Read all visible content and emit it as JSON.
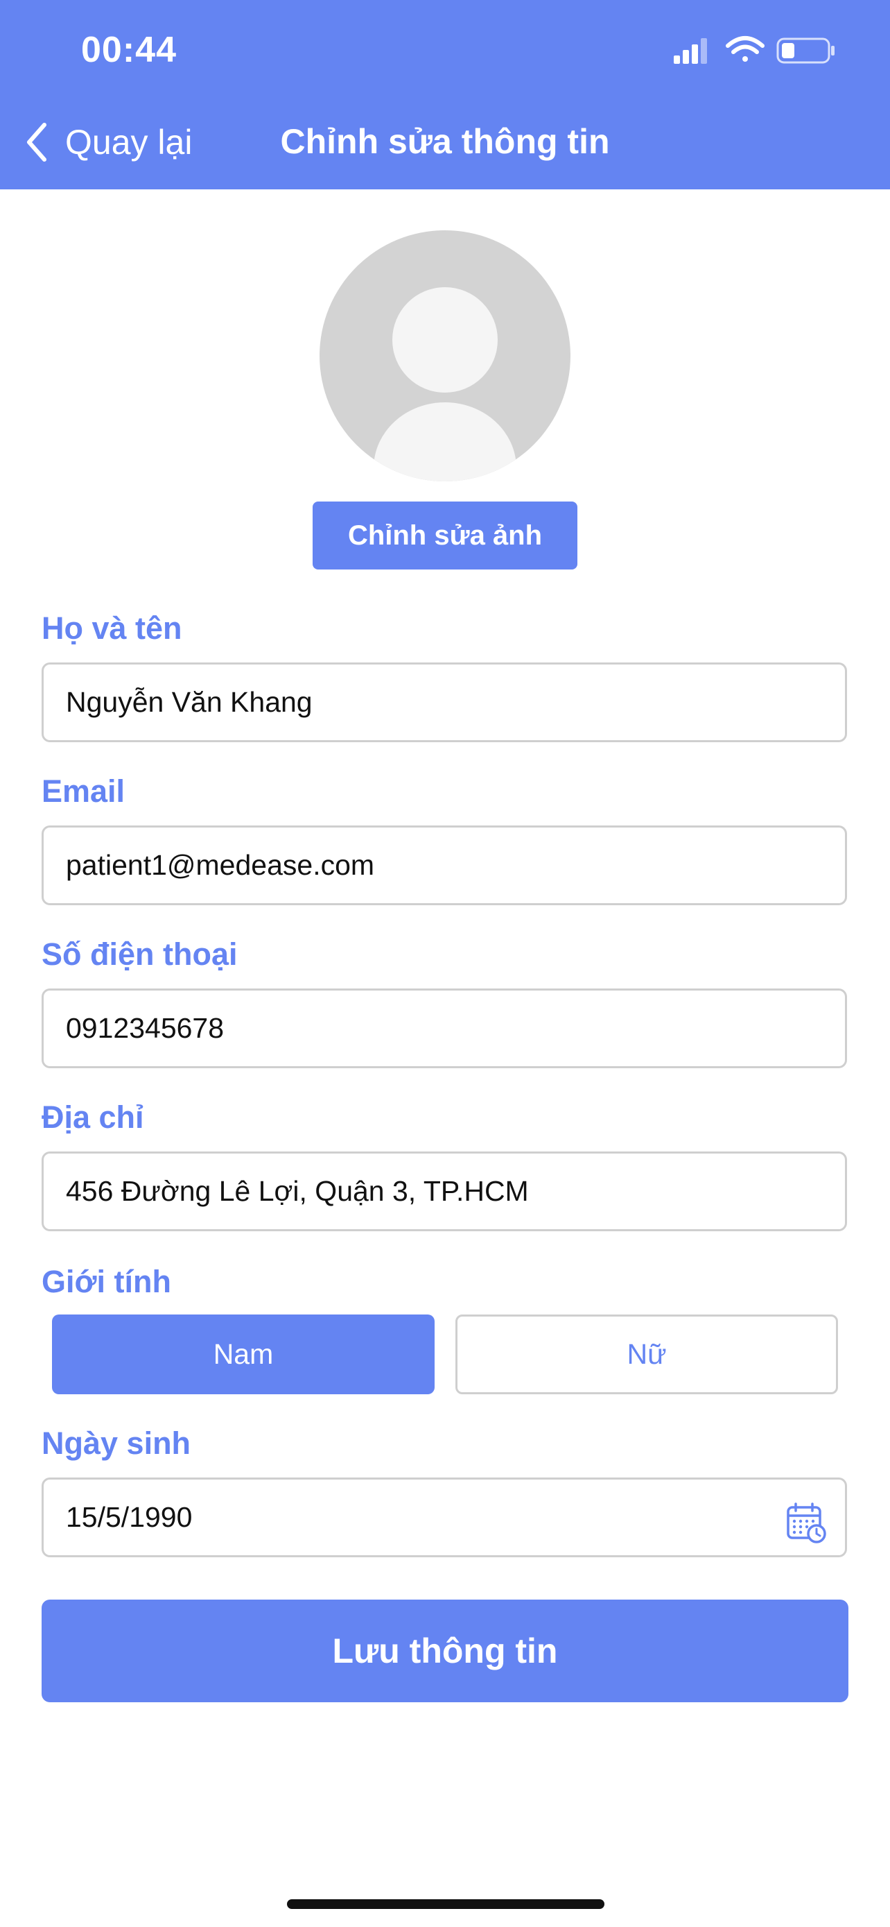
{
  "status_bar": {
    "time": "00:44",
    "icons": [
      "signal-icon",
      "wifi-icon",
      "battery-icon"
    ]
  },
  "nav": {
    "back_label": "Quay lại",
    "title": "Chỉnh sửa thông tin"
  },
  "profile": {
    "edit_photo_label": "Chỉnh sửa ảnh"
  },
  "form": {
    "full_name": {
      "label": "Họ và tên",
      "value": "Nguyễn Văn Khang"
    },
    "email": {
      "label": "Email",
      "value": "patient1@medease.com"
    },
    "phone": {
      "label": "Số điện thoại",
      "value": "0912345678"
    },
    "address": {
      "label": "Địa chỉ",
      "value": "456 Đường Lê Lợi, Quận 3, TP.HCM"
    },
    "gender": {
      "label": "Giới tính",
      "options": [
        "Nam",
        "Nữ"
      ],
      "selected": "Nam"
    },
    "birthdate": {
      "label": "Ngày sinh",
      "value": "15/5/1990",
      "icon": "calendar-icon"
    }
  },
  "save_label": "Lưu thông tin",
  "colors": {
    "accent": "#6484F2",
    "border": "#CFCFCF",
    "avatar_bg": "#D3D3D3"
  }
}
